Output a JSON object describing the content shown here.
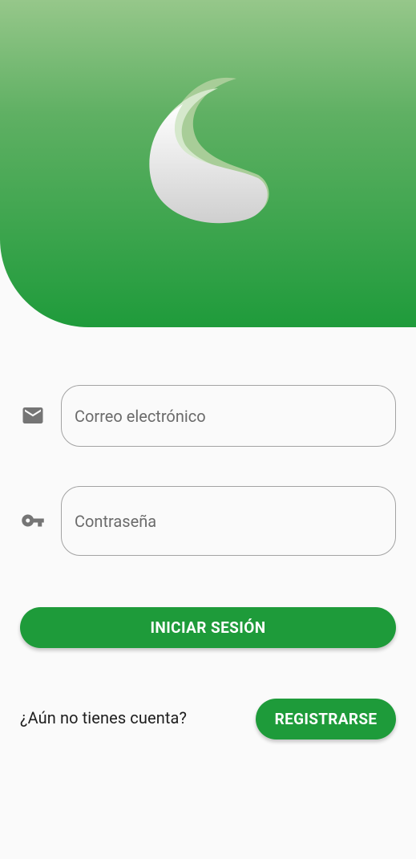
{
  "app": {
    "logo_icon": "crescent-moon-logo-icon"
  },
  "form": {
    "email": {
      "icon": "mail-icon",
      "placeholder": "Correo electrónico",
      "value": ""
    },
    "password": {
      "icon": "key-icon",
      "placeholder": "Contraseña",
      "value": ""
    },
    "login_label": "INICIAR SESIÓN"
  },
  "register": {
    "prompt": "¿Aún no tienes cuenta?",
    "button_label": "REGISTRARSE"
  },
  "colors": {
    "primary": "#1e9b3a",
    "header_top": "#96c78a",
    "header_bottom": "#1f9b3b",
    "background": "#fafafa",
    "icon_grey": "#757575"
  }
}
